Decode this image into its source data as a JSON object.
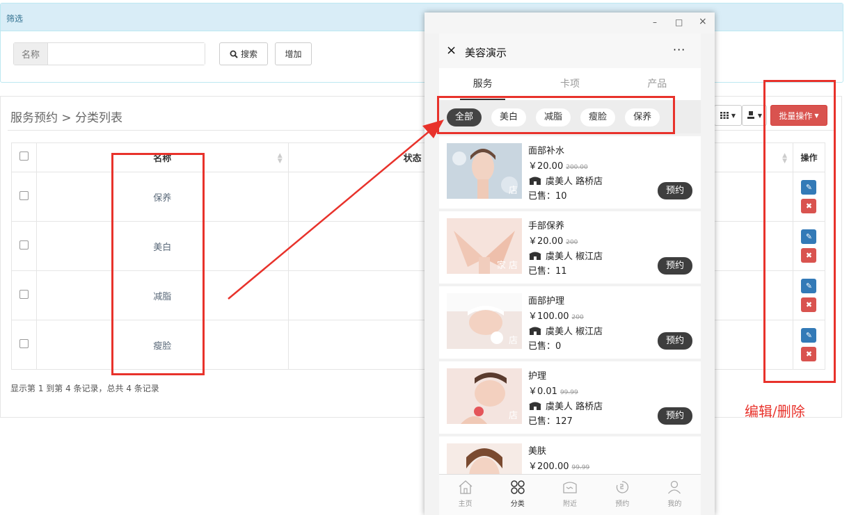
{
  "filter": {
    "title": "筛选",
    "name_label": "名称",
    "name_value": "",
    "search_label": "搜索",
    "add_label": "增加"
  },
  "list": {
    "breadcrumb": "服务预约 > 分类列表",
    "batch_label": "批量操作",
    "columns": [
      "名称",
      "状态",
      "操作"
    ],
    "rows": [
      {
        "name": "保养"
      },
      {
        "name": "美白"
      },
      {
        "name": "减脂"
      },
      {
        "name": "瘦脸"
      }
    ],
    "pager_info": "显示第 1 到第 4 条记录，总共 4 条记录"
  },
  "annotation": {
    "label": "编辑/删除",
    "color": "#e8322b"
  },
  "window": {
    "minimize": "–",
    "maximize": "□",
    "close": "×"
  },
  "miniprogram": {
    "close": "×",
    "title": "美容演示",
    "more": "···",
    "tabs": [
      "服务",
      "卡项",
      "产品"
    ],
    "active_tab": "服务",
    "categories": [
      "全部",
      "美白",
      "减脂",
      "瘦脸",
      "保养"
    ],
    "active_category": "全部",
    "services": [
      {
        "name": "面部补水",
        "price": "￥20.00",
        "orig_price": "200.00",
        "shop": "虞美人 路桥店",
        "sold": "已售：10",
        "tag": "店",
        "book": "预约"
      },
      {
        "name": "手部保养",
        "price": "￥20.00",
        "orig_price": "200",
        "shop": "虞美人 椒江店",
        "sold": "已售：11",
        "tag": "家 店",
        "book": "预约"
      },
      {
        "name": "面部护理",
        "price": "￥100.00",
        "orig_price": "200",
        "shop": "虞美人 椒江店",
        "sold": "已售：0",
        "tag": "店",
        "book": "预约"
      },
      {
        "name": "护理",
        "price": "￥0.01",
        "orig_price": "99.99",
        "shop": "虞美人 路桥店",
        "sold": "已售：127",
        "tag": "店",
        "book": "预约"
      },
      {
        "name": "美肤",
        "price": "￥200.00",
        "orig_price": "99.99",
        "shop": "",
        "sold": "",
        "tag": "",
        "book": ""
      }
    ],
    "tabbar": [
      {
        "label": "主页",
        "icon": "home-icon"
      },
      {
        "label": "分类",
        "icon": "category-icon"
      },
      {
        "label": "附近",
        "icon": "nearby-icon"
      },
      {
        "label": "预约",
        "icon": "booking-icon"
      },
      {
        "label": "我的",
        "icon": "profile-icon"
      }
    ],
    "active_tabbar": "分类"
  }
}
